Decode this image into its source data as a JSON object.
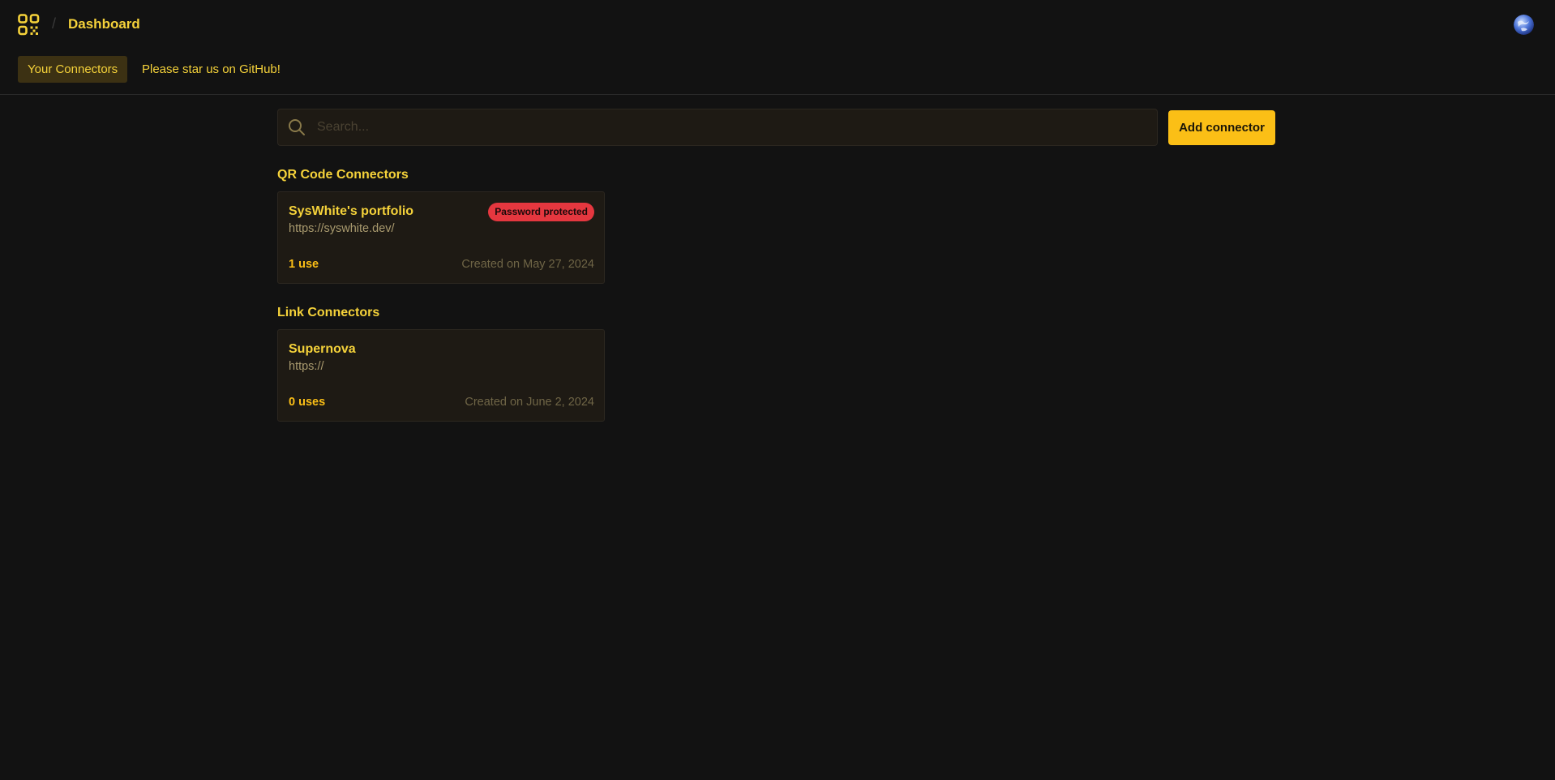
{
  "header": {
    "title": "Dashboard",
    "separator": "/"
  },
  "tabs": [
    {
      "label": "Your Connectors",
      "active": true
    },
    {
      "label": "Please star us on GitHub!",
      "active": false
    }
  ],
  "search": {
    "placeholder": "Search...",
    "value": ""
  },
  "actions": {
    "add_label": "Add connector"
  },
  "sections": [
    {
      "title": "QR Code Connectors",
      "cards": [
        {
          "title": "SysWhite's portfolio",
          "url": "https://syswhite.dev/",
          "badge": "Password protected",
          "uses": "1 use",
          "created": "Created on May 27, 2024"
        }
      ]
    },
    {
      "title": "Link Connectors",
      "cards": [
        {
          "title": "Supernova",
          "url": "https://",
          "uses": "0 uses",
          "created": "Created on June 2, 2024"
        }
      ]
    }
  ],
  "colors": {
    "background": "#121212",
    "accent": "#f5d23a",
    "button": "#fbbf16",
    "card": "#1e1a14",
    "badge": "#e5373f"
  },
  "icons": {
    "logo": "qr-code-icon",
    "search": "search-icon",
    "avatar": "avatar"
  }
}
